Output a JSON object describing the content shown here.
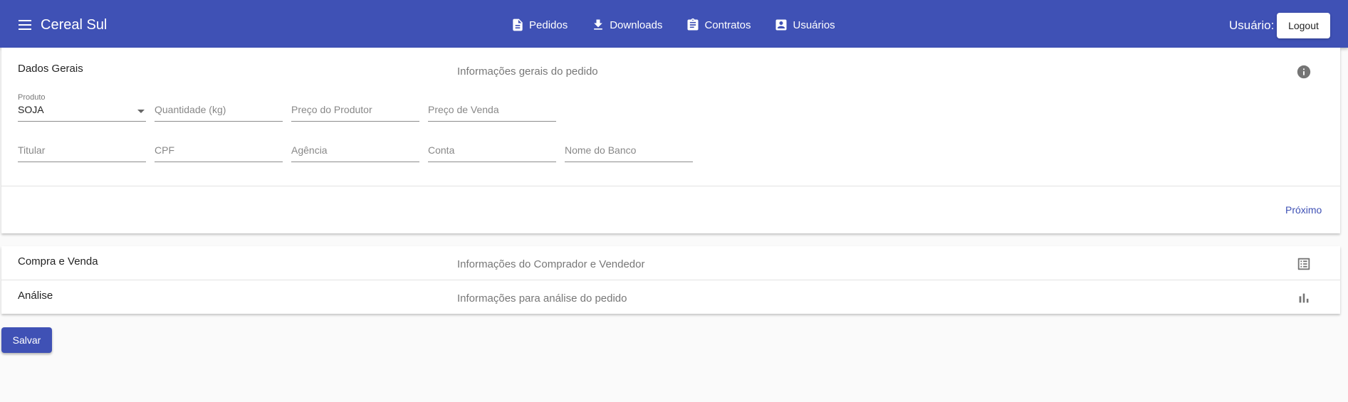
{
  "app": {
    "title": "Cereal Sul"
  },
  "nav": {
    "items": [
      {
        "label": "Pedidos",
        "icon": "document-icon"
      },
      {
        "label": "Downloads",
        "icon": "download-icon"
      },
      {
        "label": "Contratos",
        "icon": "clipboard-icon"
      },
      {
        "label": "Usuários",
        "icon": "account-box-icon"
      }
    ]
  },
  "user": {
    "label": "Usuário:",
    "logout_label": "Logout"
  },
  "sections": {
    "dados_gerais": {
      "title": "Dados Gerais",
      "description": "Informações gerais do pedido",
      "icon": "info-icon",
      "produto_label": "Produto",
      "produto_value": "SOJA",
      "fields": {
        "quantidade": "Quantidade (kg)",
        "preco_produtor": "Preço do Produtor",
        "preco_venda": "Preço de Venda",
        "titular": "Titular",
        "cpf": "CPF",
        "agencia": "Agência",
        "conta": "Conta",
        "nome_banco": "Nome do Banco"
      },
      "next_label": "Próximo"
    },
    "compra_venda": {
      "title": "Compra e Venda",
      "description": "Informações do Comprador e Vendedor",
      "icon": "list-alt-icon"
    },
    "analise": {
      "title": "Análise",
      "description": "Informações para análise do pedido",
      "icon": "bar-chart-icon"
    }
  },
  "actions": {
    "save_label": "Salvar"
  },
  "colors": {
    "primary": "#3f51b5",
    "background": "#fafafa"
  }
}
